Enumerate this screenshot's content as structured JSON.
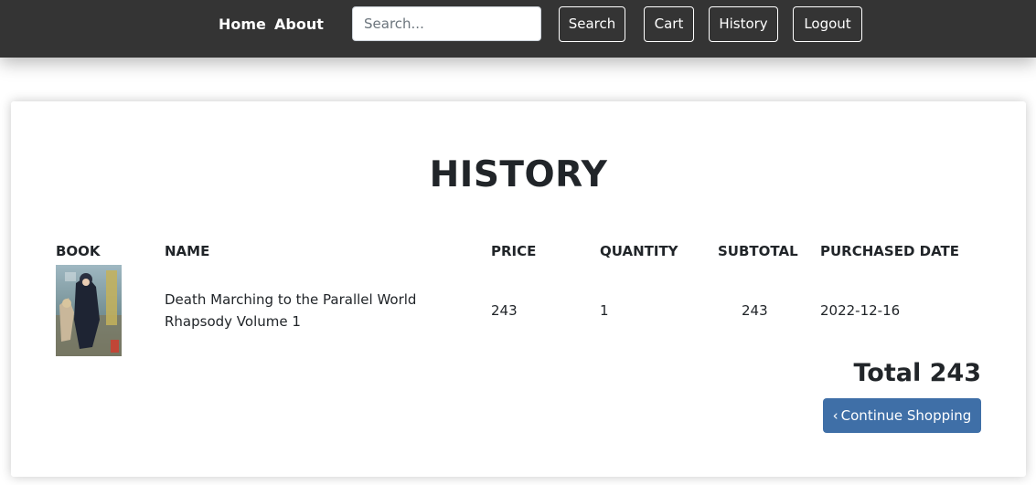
{
  "nav": {
    "home": "Home",
    "about": "About",
    "search_placeholder": "Search...",
    "search_button": "Search",
    "cart": "Cart",
    "history": "History",
    "logout": "Logout"
  },
  "page": {
    "title": "HISTORY"
  },
  "table": {
    "headers": [
      "BOOK",
      "NAME",
      "PRICE",
      "QUANTITY",
      "SUBTOTAL",
      "PURCHASED DATE"
    ],
    "rows": [
      {
        "name": "Death Marching to the Parallel World Rhapsody Volume 1",
        "price": "243",
        "quantity": "1",
        "subtotal": "243",
        "purchased_date": "2022-12-16"
      }
    ]
  },
  "summary": {
    "total": "Total 243",
    "continue_button": "Continue Shopping",
    "continue_icon": "chevron-left-icon"
  },
  "colors": {
    "navbar": "#343434",
    "primary_button": "#3f6fa7"
  }
}
